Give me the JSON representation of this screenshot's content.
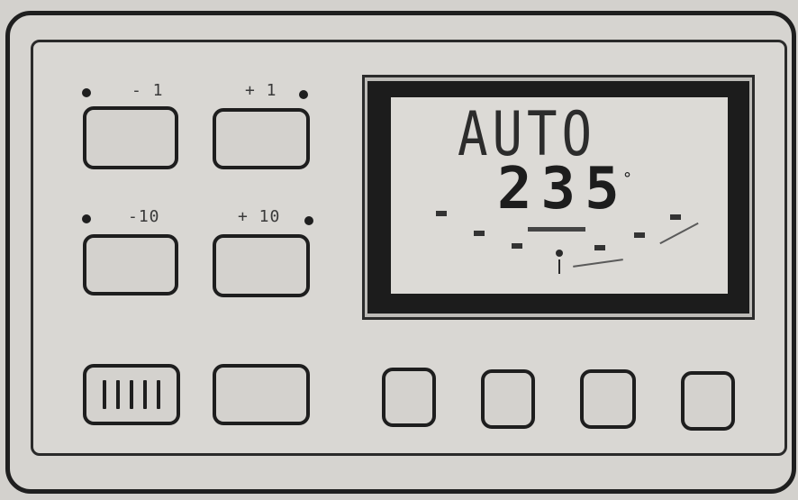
{
  "keypad": {
    "minus_1": "- 1",
    "plus_1": "+ 1",
    "minus_10": "-10",
    "plus_10": "+ 10"
  },
  "display": {
    "mode": "AUTO",
    "heading": "235",
    "degree_symbol": "°"
  }
}
